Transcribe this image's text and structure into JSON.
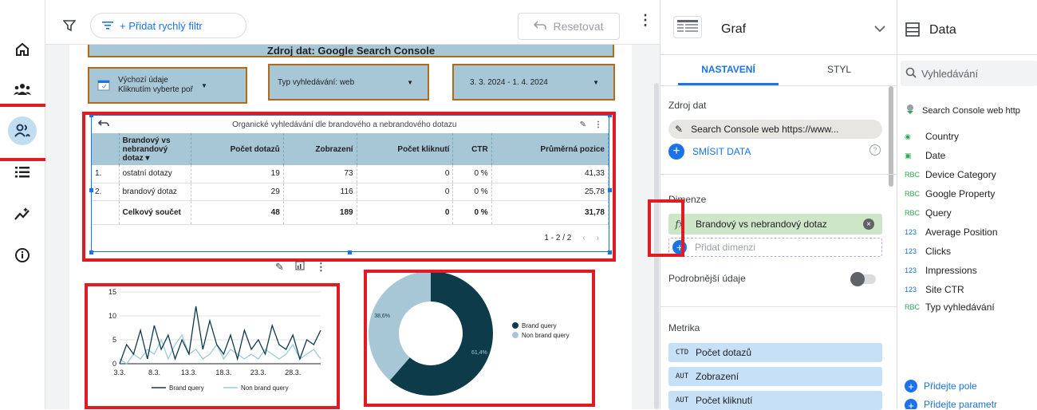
{
  "toolbar": {
    "quick_filter": "+ Přidat rychlý filtr",
    "reset": "Resetovat"
  },
  "report": {
    "header_text": "Zdroj dat: Google Search Console",
    "controls": [
      {
        "line1": "Výchozí údaje",
        "line2": "Kliknutím vyberte poř"
      },
      {
        "line1": "Typ vyhledávání: web",
        "line2": ""
      },
      {
        "line1": "3. 3. 2024 - 1. 4. 2024",
        "line2": ""
      }
    ],
    "table_title": "Organické vyhledávání dle brandového a nebrandového dotazu",
    "columns": [
      "",
      "Brandový vs nebrandový dotaz",
      "Počet dotazů",
      "Zobrazení",
      "Počet kliknutí",
      "CTR",
      "Průměrná pozice"
    ],
    "rows": [
      [
        "1.",
        "ostatní dotazy",
        "19",
        "73",
        "0",
        "0 %",
        "41,33"
      ],
      [
        "2.",
        "brandový dotaz",
        "29",
        "116",
        "0",
        "0 %",
        "25,78"
      ]
    ],
    "total": [
      "",
      "Celkový součet",
      "48",
      "189",
      "0",
      "0 %",
      "31,78"
    ],
    "pagination": "1 - 2 / 2"
  },
  "chart_data": [
    {
      "type": "line",
      "x": [
        "3.3.",
        "4.3.",
        "5.3.",
        "6.3.",
        "7.3.",
        "8.3.",
        "9.3.",
        "10.3.",
        "11.3.",
        "12.3.",
        "13.3.",
        "14.3.",
        "15.3.",
        "16.3.",
        "17.3.",
        "18.3.",
        "19.3.",
        "20.3.",
        "21.3.",
        "22.3.",
        "23.3.",
        "24.3.",
        "25.3.",
        "26.3.",
        "27.3.",
        "28.3.",
        "29.3.",
        "30.3.",
        "31.3.",
        "1.4."
      ],
      "xticks": [
        "3.3.",
        "8.3.",
        "13.3.",
        "18.3.",
        "23.3.",
        "28.3."
      ],
      "yticks": [
        0,
        5,
        10,
        15
      ],
      "ylim": [
        0,
        15
      ],
      "series": [
        {
          "name": "Brand query",
          "color": "#0d3b4a",
          "values": [
            0,
            4,
            2,
            7,
            1,
            8,
            3,
            6,
            1,
            5,
            2,
            12,
            3,
            9,
            4,
            2,
            6,
            1,
            7,
            3,
            5,
            2,
            8,
            4,
            3,
            6,
            1,
            5,
            4,
            7
          ]
        },
        {
          "name": "Non brand query",
          "color": "#9ccad8",
          "values": [
            1,
            0,
            2,
            1,
            3,
            2,
            5,
            1,
            4,
            6,
            2,
            3,
            1,
            2,
            4,
            1,
            3,
            2,
            1,
            2,
            1,
            3,
            2,
            1,
            2,
            4,
            1,
            2,
            3,
            1
          ]
        }
      ]
    },
    {
      "type": "pie",
      "donut": true,
      "slices": [
        {
          "name": "Brand query",
          "value": 61.4,
          "label": "61,4%",
          "color": "#0d3b4a"
        },
        {
          "name": "Non brand query",
          "value": 38.6,
          "label": "38,6%",
          "color": "#a7c7d6"
        }
      ]
    }
  ],
  "props": {
    "title": "Graf",
    "tabs": [
      "NASTAVENÍ",
      "STYL"
    ],
    "source_label": "Zdroj dat",
    "source_value": "Search Console web https://www...",
    "blend": "SMÍSIT DATA",
    "dimension_label": "Dimenze",
    "dimension_value": "Brandový vs nebrandový dotaz",
    "add_dimension": "Přidat dimenzi",
    "drilldown": "Podrobnější údaje",
    "metric_label": "Metrika",
    "metrics": [
      {
        "type": "CTD",
        "name": "Počet dotazů"
      },
      {
        "type": "AUT",
        "name": "Zobrazení"
      },
      {
        "type": "AUT",
        "name": "Počet kliknutí"
      }
    ]
  },
  "data_panel": {
    "title": "Data",
    "search_placeholder": "Vyhledávání",
    "source": "Search Console web http",
    "fields": [
      {
        "type": "geo",
        "name": "Country"
      },
      {
        "type": "date",
        "name": "Date"
      },
      {
        "type": "RBC",
        "name": "Device Category"
      },
      {
        "type": "RBC",
        "name": "Google Property"
      },
      {
        "type": "RBC",
        "name": "Query"
      },
      {
        "type": "123",
        "name": "Average Position"
      },
      {
        "type": "123",
        "name": "Clicks"
      },
      {
        "type": "123",
        "name": "Impressions"
      },
      {
        "type": "123",
        "name": "Site CTR"
      },
      {
        "type": "RBC",
        "name": "Typ vyhledávání"
      }
    ],
    "add_field": "Přidejte pole",
    "add_param": "Přidejte parametr"
  }
}
